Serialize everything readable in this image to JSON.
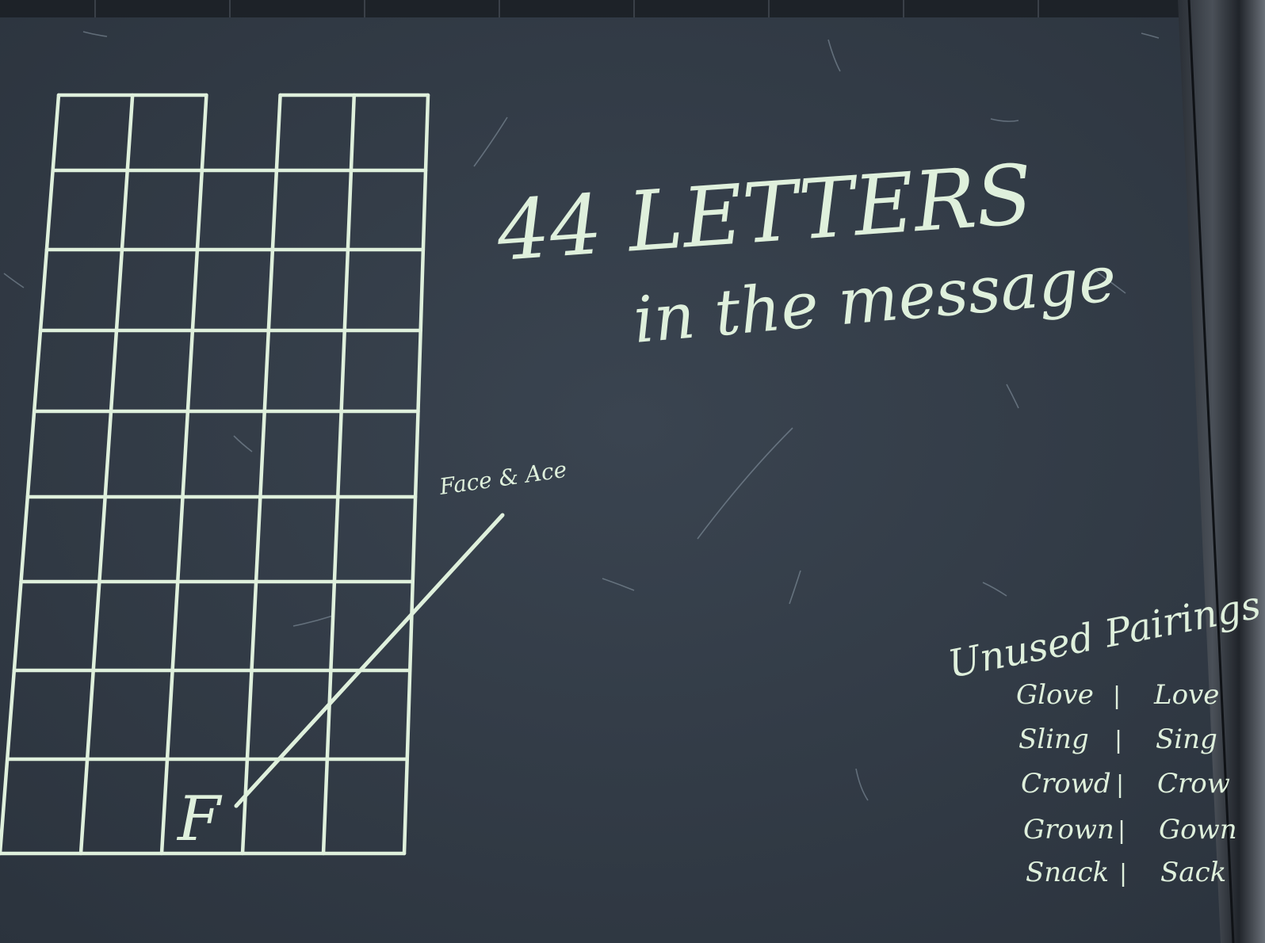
{
  "board": {
    "headline": "44 LETTERS",
    "subline": "in the message",
    "grid_cell_letter": "F",
    "annotation": "Face & Ace",
    "grid_columns": 5,
    "grid_rows": 9
  },
  "unused_pairings": {
    "title": "Unused Pairings",
    "separator": "|",
    "pairs": [
      {
        "left": "Glove",
        "right": "Love"
      },
      {
        "left": "Sling",
        "right": "Sing"
      },
      {
        "left": "Crowd",
        "right": "Crow"
      },
      {
        "left": "Grown",
        "right": "Gown"
      },
      {
        "left": "Snack",
        "right": "Sack"
      }
    ]
  },
  "colors": {
    "chalk": "#dff0dc",
    "board": "#323c48",
    "frame": "#1c2026"
  }
}
